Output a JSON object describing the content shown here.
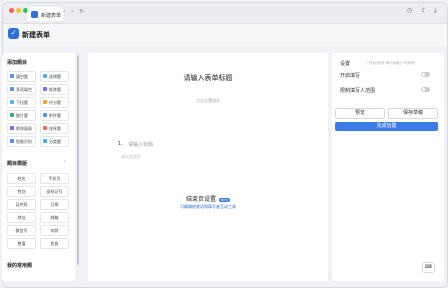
{
  "tab": {
    "title": "新建表单",
    "close": "×"
  },
  "titlebar": {
    "back": "‹",
    "forward": "›",
    "reload": "↻"
  },
  "app": {
    "logo": "✓",
    "title": "新建表单"
  },
  "sidebar": {
    "add_heading": "添加题目",
    "fields": [
      {
        "label": "填空题",
        "color": "#5b8def"
      },
      {
        "label": "选择题",
        "color": "#4cb3e8"
      },
      {
        "label": "多项填空",
        "color": "#5b8def"
      },
      {
        "label": "矩阵题",
        "color": "#7a6cf0"
      },
      {
        "label": "下拉题",
        "color": "#4cb3e8"
      },
      {
        "label": "评分题",
        "color": "#f5a623"
      },
      {
        "label": "图片题",
        "color": "#3aa776"
      },
      {
        "label": "附件题",
        "color": "#5b8def"
      },
      {
        "label": "矩阵填表",
        "color": "#7a6cf0"
      },
      {
        "label": "排序题",
        "color": "#f26b5b"
      },
      {
        "label": "智能识别",
        "color": "#5b8def"
      },
      {
        "label": "分类题",
        "color": "#4cb3e8"
      }
    ],
    "template_heading": "题目模版",
    "template_chevron": "⌃",
    "templates": [
      "姓名",
      "手机号",
      "性别",
      "身份证号",
      "证件照",
      "日期",
      "地址",
      "邮箱",
      "微信号",
      "年龄",
      "数值",
      "民族"
    ],
    "common_heading": "我的常用题"
  },
  "form": {
    "title": "请输入表单标题",
    "description": "点击设置描述",
    "question_number": "1.",
    "question_title": "请输入标题",
    "question_hint": "请在此填写",
    "end_title": "结束页设置",
    "end_badge": "NEW",
    "end_desc": "可编辑结束语和填写者互动工具"
  },
  "panel": {
    "settings_label": "设置",
    "settings_hint": "(\"开启/关闭\"单页功能)  \"可修改\"",
    "toggle1_label": "开启填写",
    "toggle2_label": "限制填写人范围",
    "preview_label": "预览",
    "save_label": "保存草稿",
    "finish_label": "完成创建"
  },
  "chat": {
    "icon": "⌨"
  },
  "colors": {
    "accent": "#3a7be8",
    "panel_bg": "#f1f2f5"
  }
}
